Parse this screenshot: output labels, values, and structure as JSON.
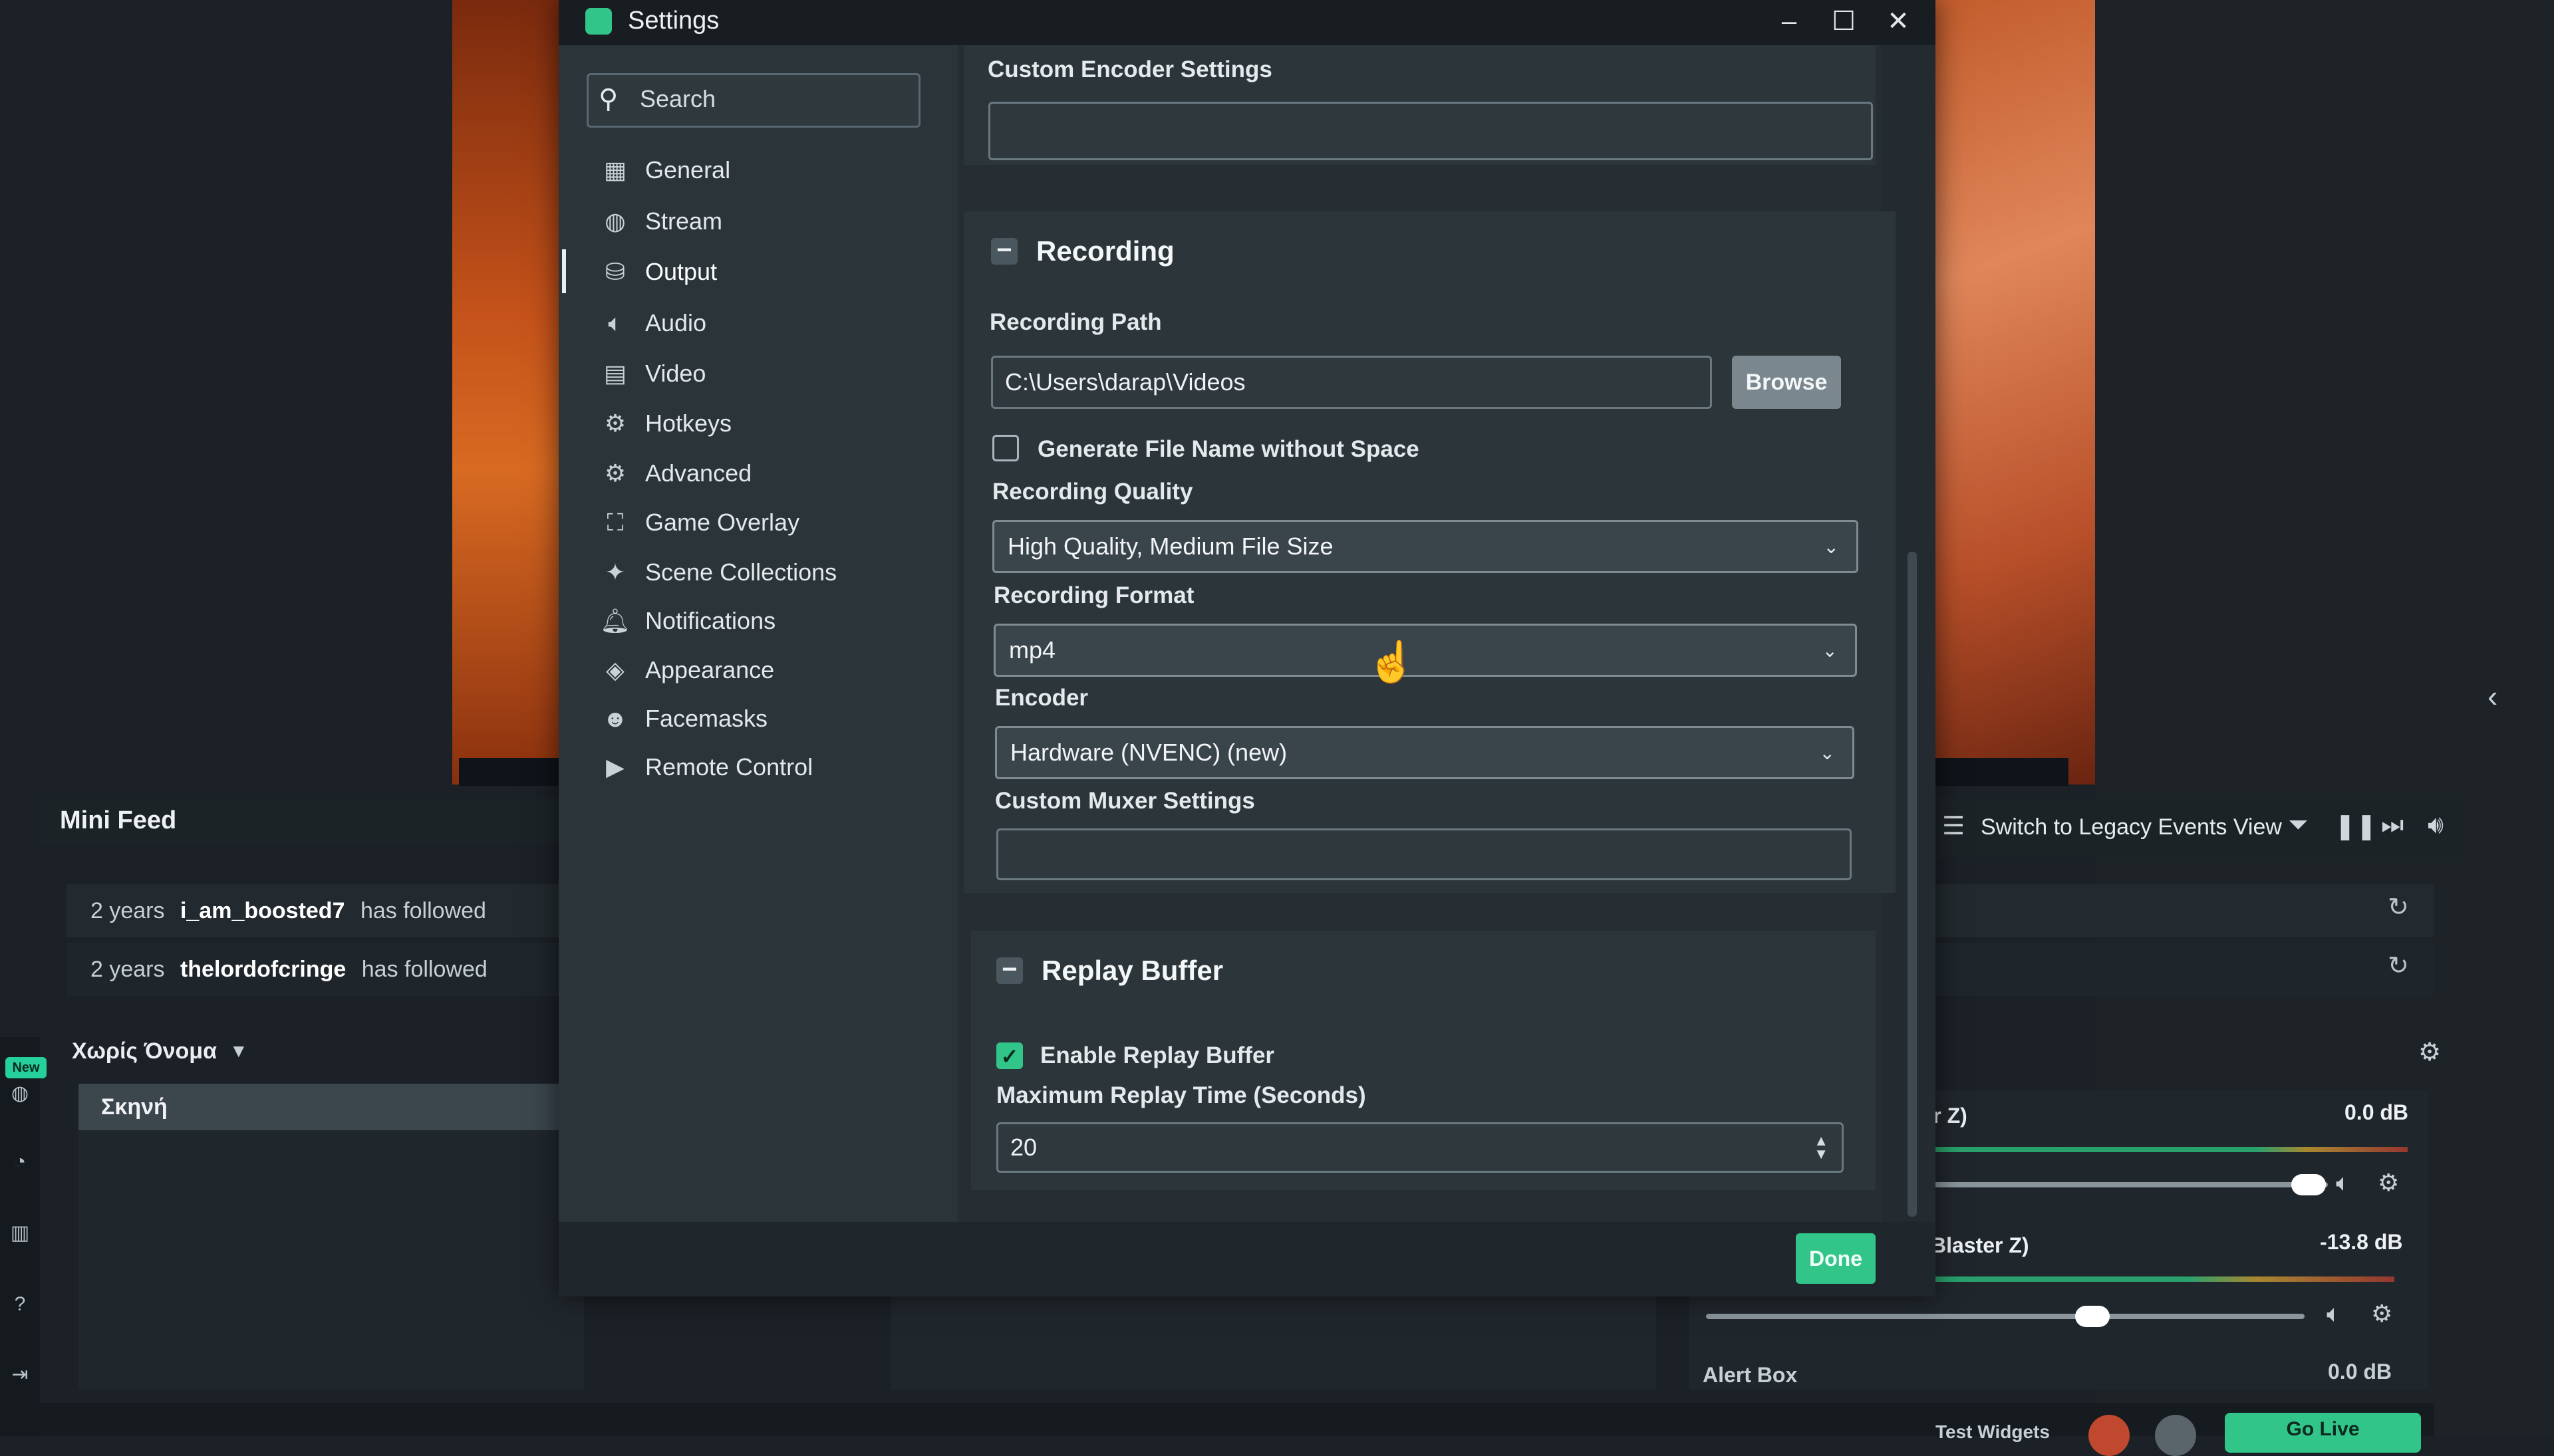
{
  "window": {
    "title": "Settings",
    "minimize_icon": "minimize-icon",
    "maximize_icon": "maximize-icon",
    "close_icon": "close-icon"
  },
  "sidebar": {
    "search_placeholder": "Search",
    "items": [
      {
        "label": "General",
        "icon": "grid-icon"
      },
      {
        "label": "Stream",
        "icon": "globe-icon"
      },
      {
        "label": "Output",
        "icon": "database-icon",
        "active": true
      },
      {
        "label": "Audio",
        "icon": "speaker-icon"
      },
      {
        "label": "Video",
        "icon": "film-icon"
      },
      {
        "label": "Hotkeys",
        "icon": "gear-icon"
      },
      {
        "label": "Advanced",
        "icon": "gears-icon"
      },
      {
        "label": "Game Overlay",
        "icon": "overlay-icon"
      },
      {
        "label": "Scene Collections",
        "icon": "wand-icon"
      },
      {
        "label": "Notifications",
        "icon": "bell-icon"
      },
      {
        "label": "Appearance",
        "icon": "palette-icon"
      },
      {
        "label": "Facemasks",
        "icon": "mask-icon"
      },
      {
        "label": "Remote Control",
        "icon": "play-circle-icon"
      }
    ]
  },
  "content": {
    "custom_encoder_label": "Custom Encoder Settings",
    "custom_encoder_value": "",
    "recording": {
      "title": "Recording",
      "path_label": "Recording Path",
      "path_value": "C:\\Users\\darap\\Videos",
      "browse_label": "Browse",
      "gen_filename_label": "Generate File Name without Space",
      "gen_filename_checked": false,
      "quality_label": "Recording Quality",
      "quality_value": "High Quality, Medium File Size",
      "format_label": "Recording Format",
      "format_value": "mp4",
      "encoder_label": "Encoder",
      "encoder_value": "Hardware (NVENC) (new)",
      "muxer_label": "Custom Muxer Settings",
      "muxer_value": ""
    },
    "replay": {
      "title": "Replay Buffer",
      "enable_label": "Enable Replay Buffer",
      "enable_checked": true,
      "max_time_label": "Maximum Replay Time (Seconds)",
      "max_time_value": "20"
    },
    "done_label": "Done"
  },
  "background": {
    "minifeed_title": "Mini Feed",
    "feed": [
      {
        "age": "2 years",
        "user": "i_am_boosted7",
        "action": "has followed"
      },
      {
        "age": "2 years",
        "user": "thelordofcringe",
        "action": "has followed"
      }
    ],
    "scene_collection_name": "Χωρίς Όνομα",
    "scene_item": "Σκηνή",
    "new_badge": "New",
    "events_view_label": "Switch to Legacy Events View",
    "mixer": [
      {
        "name": "ster Z)",
        "db": "0.0 dB",
        "level": 0.85
      },
      {
        "name": "nd Blaster Z)",
        "db": "-13.8 dB",
        "level": 0.55
      }
    ],
    "alert_box": "Alert Box",
    "alert_db": "0.0 dB",
    "test_widgets": "Test Widgets",
    "go_live": "Go Live"
  },
  "colors": {
    "accent": "#31c58a",
    "panel": "#2c353a",
    "sidebar": "#2b3439"
  }
}
